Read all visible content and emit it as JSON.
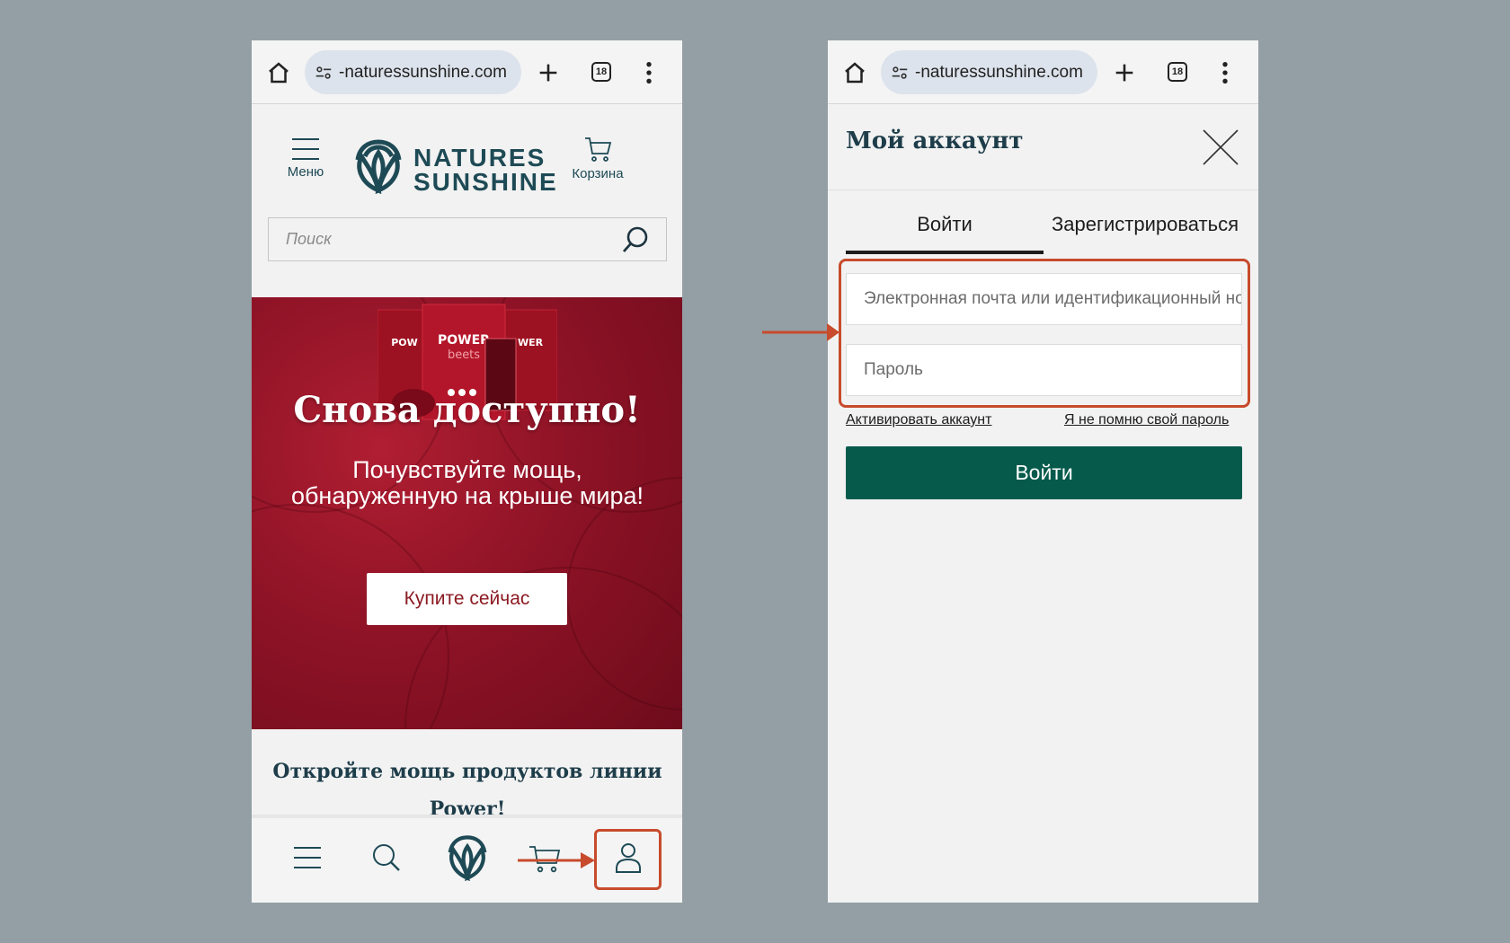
{
  "colors": {
    "background": "#939fa5",
    "annotation": "#c74b2c",
    "brand_dark": "#1e4a55",
    "login_button": "#055a4b",
    "hero_red": "#8f1326"
  },
  "browser": {
    "url": "-naturessunshine.com",
    "tab_count": "18",
    "icons": [
      "home-icon",
      "site-settings-icon",
      "new-tab-icon",
      "tabs-icon",
      "more-icon"
    ]
  },
  "left_screen": {
    "header": {
      "menu_label": "Меню",
      "logo_line1": "NATURES",
      "logo_line2": "SUNSHINE",
      "cart_label": "Корзина"
    },
    "search": {
      "placeholder": "Поиск"
    },
    "hero": {
      "title": "Снова доступно!",
      "subtitle": "Почувствуйте мощь, обнаруженную на крыше мира!",
      "button": "Купите сейчас",
      "product_name": "POWER beets"
    },
    "section_title": "Откройте мощь продуктов линии Power!",
    "bottom_nav": [
      "menu-icon",
      "search-icon",
      "logo-icon",
      "cart-icon",
      "account-icon"
    ]
  },
  "right_screen": {
    "title": "Мой аккаунт",
    "tabs": {
      "login": "Войти",
      "register": "Зарегистрироваться"
    },
    "email_placeholder": "Электронная почта или идентификационный номер",
    "password_placeholder": "Пароль",
    "activate_link": "Активировать аккаунт",
    "forgot_link": "Я не помню свой пароль",
    "login_button": "Войти"
  }
}
